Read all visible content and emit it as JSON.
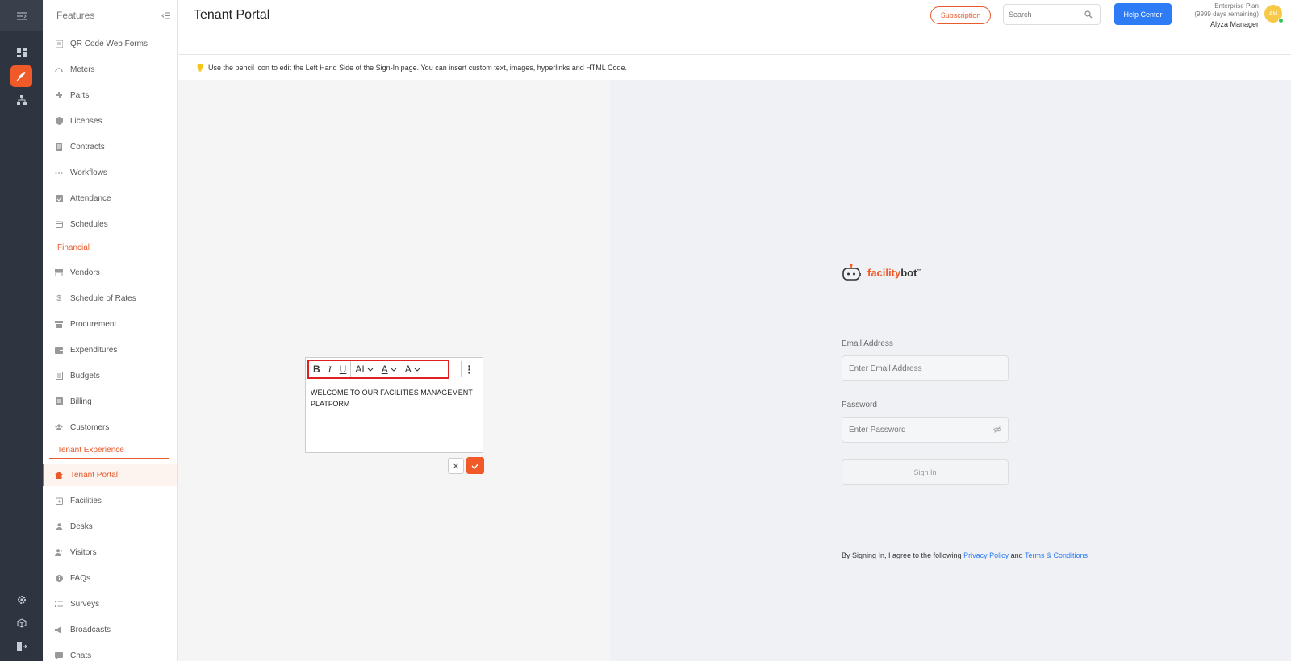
{
  "topbar": {
    "title": "Tenant Portal",
    "subscription_label": "Subscription",
    "search_placeholder": "Search",
    "help_label": "Help Center",
    "plan_name": "Enterprise Plan",
    "plan_days": "(9999 days remaining)",
    "user_name": "Alyza Manager",
    "avatar_initials": "AM"
  },
  "sidebar": {
    "title": "Features",
    "items": [
      {
        "label": "QR Code Web Forms",
        "icon": "qr-form-icon"
      },
      {
        "label": "Meters",
        "icon": "gauge-icon"
      },
      {
        "label": "Parts",
        "icon": "puzzle-icon"
      },
      {
        "label": "Licenses",
        "icon": "shield-icon"
      },
      {
        "label": "Contracts",
        "icon": "document-icon"
      },
      {
        "label": "Workflows",
        "icon": "dots-icon"
      },
      {
        "label": "Attendance",
        "icon": "calendar-check-icon"
      },
      {
        "label": "Schedules",
        "icon": "calendar-icon"
      }
    ],
    "section_financial": "Financial",
    "financial_items": [
      {
        "label": "Vendors",
        "icon": "store-icon"
      },
      {
        "label": "Schedule of Rates",
        "icon": "dollar-icon"
      },
      {
        "label": "Procurement",
        "icon": "shop-icon"
      },
      {
        "label": "Expenditures",
        "icon": "wallet-icon"
      },
      {
        "label": "Budgets",
        "icon": "ledger-icon"
      },
      {
        "label": "Billing",
        "icon": "receipt-icon"
      },
      {
        "label": "Customers",
        "icon": "group-icon"
      }
    ],
    "section_tenant": "Tenant Experience",
    "tenant_items": [
      {
        "label": "Tenant Portal",
        "icon": "house-icon"
      },
      {
        "label": "Facilities",
        "icon": "calendar-plus-icon"
      },
      {
        "label": "Desks",
        "icon": "person-icon"
      },
      {
        "label": "Visitors",
        "icon": "visitor-icon"
      },
      {
        "label": "FAQs",
        "icon": "info-icon"
      },
      {
        "label": "Surveys",
        "icon": "list-icon"
      },
      {
        "label": "Broadcasts",
        "icon": "megaphone-icon"
      },
      {
        "label": "Chats",
        "icon": "chat-icon"
      }
    ]
  },
  "info": {
    "text": "Use the pencil icon to edit the Left Hand Side of the Sign-In page. You can insert custom text, images, hyperlinks and HTML Code."
  },
  "editor": {
    "content": "WELCOME TO OUR FACILITIES MANAGEMENT PLATFORM",
    "bold": "B",
    "italic": "I",
    "underline": "U",
    "font_size": "AI",
    "font_color": "A",
    "format": "A"
  },
  "signin": {
    "logo_part1": "facility",
    "logo_part2": "bot",
    "logo_tm": "™",
    "email_label": "Email Address",
    "email_placeholder": "Enter Email Address",
    "password_label": "Password",
    "password_placeholder": "Enter Password",
    "button": "Sign In",
    "agree_prefix": "By Signing In, I agree to the following ",
    "privacy": "Privacy Policy",
    "and": " and ",
    "terms": "Terms & Conditions"
  },
  "colors": {
    "accent": "#f05a28",
    "blue": "#2d7cf5",
    "rail": "#2f3540"
  }
}
